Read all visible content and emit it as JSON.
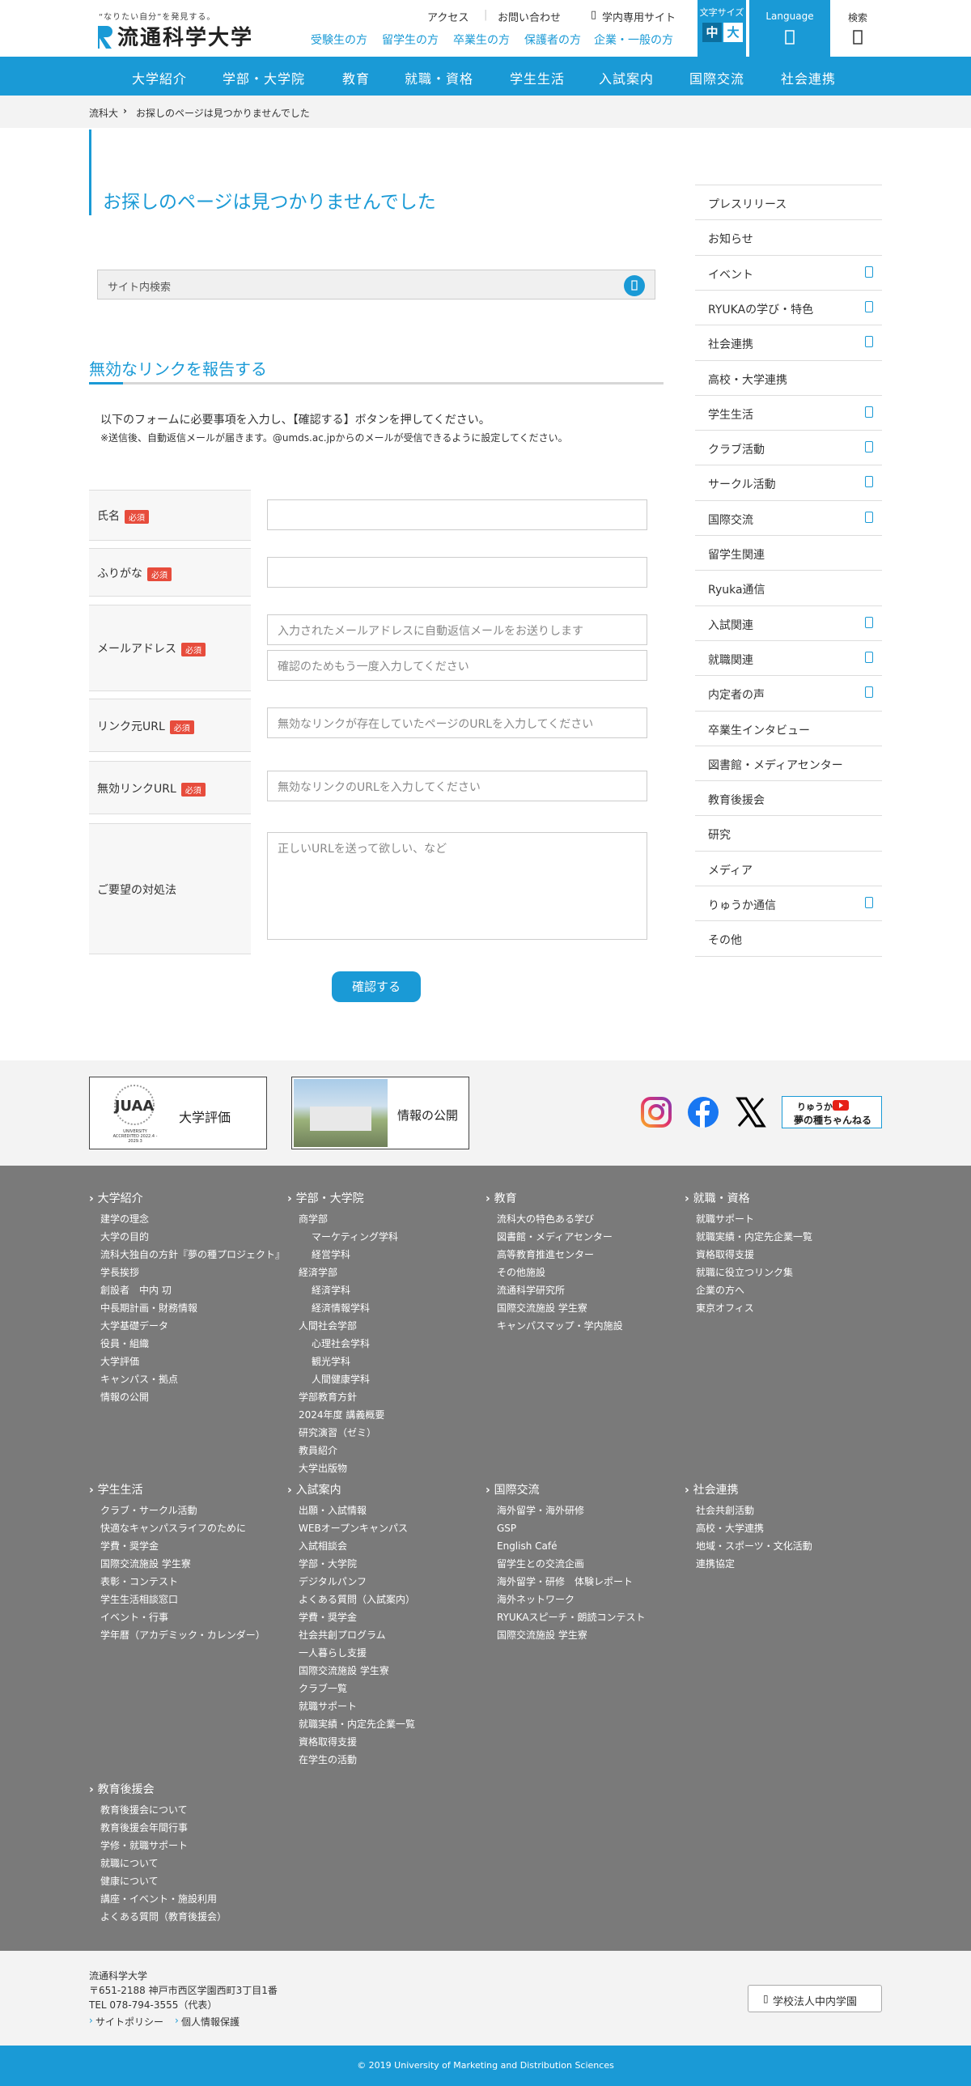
{
  "header": {
    "tagline": "“なりたい自分”を発見する。",
    "logo_name": "流通科学大学",
    "util_links": [
      "アクセス",
      "お問い合わせ",
      "学内専用サイト"
    ],
    "audience_links": [
      "受験生の方",
      "留学生の方",
      "卒業生の方",
      "保護者の方",
      "企業・一般の方"
    ],
    "fontsize_label": "文字サイズ",
    "fontsize_medium": "中",
    "fontsize_large": "大",
    "language_label": "Language",
    "search_label": "検索"
  },
  "gnav": [
    "大学紹介",
    "学部・大学院",
    "教育",
    "就職・資格",
    "学生生活",
    "入試案内",
    "国際交流",
    "社会連携"
  ],
  "breadcrumb": {
    "home": "流科大",
    "current": "お探しのページは見つかりませんでした"
  },
  "main": {
    "title": "お探しのページは見つかりませんでした",
    "site_search_placeholder": "サイト内検索",
    "section_title": "無効なリンクを報告する",
    "intro": "以下のフォームに必要事項を入力し、【確認する】ボタンを押してください。",
    "note": "※送信後、自動返信メールが届きます。@umds.ac.jpからのメールが受信できるように設定してください。",
    "required_badge": "必須",
    "form": {
      "name_label": "氏名",
      "kana_label": "ふりがな",
      "email_label": "メールアドレス",
      "email_placeholder": "入力されたメールアドレスに自動返信メールをお送りします",
      "email_confirm_placeholder": "確認のためもう一度入力してください",
      "source_url_label": "リンク元URL",
      "source_url_placeholder": "無効なリンクが存在していたページのURLを入力してください",
      "invalid_url_label": "無効リンクURL",
      "invalid_url_placeholder": "無効なリンクのURLを入力してください",
      "request_label": "ご要望の対処法",
      "request_placeholder": "正しいURLを送って欲しい、など"
    },
    "confirm_button": "確認する"
  },
  "sidebar": [
    {
      "label": "プレスリリース",
      "sub": false
    },
    {
      "label": "お知らせ",
      "sub": false
    },
    {
      "label": "イベント",
      "sub": true
    },
    {
      "label": "RYUKAの学び・特色",
      "sub": true
    },
    {
      "label": "社会連携",
      "sub": true
    },
    {
      "label": "高校・大学連携",
      "sub": false
    },
    {
      "label": "学生生活",
      "sub": true
    },
    {
      "label": "クラブ活動",
      "sub": true
    },
    {
      "label": "サークル活動",
      "sub": true
    },
    {
      "label": "国際交流",
      "sub": true
    },
    {
      "label": "留学生関連",
      "sub": false
    },
    {
      "label": "Ryuka通信",
      "sub": false
    },
    {
      "label": "入試関連",
      "sub": true
    },
    {
      "label": "就職関連",
      "sub": true
    },
    {
      "label": "内定者の声",
      "sub": true
    },
    {
      "label": "卒業生インタビュー",
      "sub": false
    },
    {
      "label": "図書館・メディアセンター",
      "sub": false
    },
    {
      "label": "教育後援会",
      "sub": false
    },
    {
      "label": "研究",
      "sub": false
    },
    {
      "label": "メディア",
      "sub": false
    },
    {
      "label": "りゅうか通信",
      "sub": true
    },
    {
      "label": "その他",
      "sub": false
    }
  ],
  "banners": {
    "eval_label": "大学評価",
    "eval_logo_text": "UNIVERSITY ACCREDITED 2022.4 - 2029.3",
    "info_label": "情報の公開",
    "yume_label_1": "りゅうか",
    "yume_label_2": "夢の種ちゃんねる",
    "sns": [
      "instagram-icon",
      "facebook-icon",
      "x-icon"
    ]
  },
  "sitemap": [
    {
      "head": "大学紹介",
      "items": [
        [
          "建学の理念",
          0
        ],
        [
          "大学の目的",
          0
        ],
        [
          "流科大独自の方針『夢の種プロジェクト』",
          0
        ],
        [
          "学長挨拶",
          0
        ],
        [
          "創設者　中内 㓛",
          0
        ],
        [
          "中長期計画・財務情報",
          0
        ],
        [
          "大学基礎データ",
          0
        ],
        [
          "役員・組織",
          0
        ],
        [
          "大学評価",
          0
        ],
        [
          "キャンパス・拠点",
          0
        ],
        [
          "情報の公開",
          0
        ]
      ]
    },
    {
      "head": "学部・大学院",
      "items": [
        [
          "商学部",
          0
        ],
        [
          "マーケティング学科",
          1
        ],
        [
          "経営学科",
          1
        ],
        [
          "経済学部",
          0
        ],
        [
          "経済学科",
          1
        ],
        [
          "経済情報学科",
          1
        ],
        [
          "人間社会学部",
          0
        ],
        [
          "心理社会学科",
          1
        ],
        [
          "観光学科",
          1
        ],
        [
          "人間健康学科",
          1
        ],
        [
          "学部教育方針",
          0
        ],
        [
          "2024年度 講義概要",
          0
        ],
        [
          "研究演習（ゼミ）",
          0
        ],
        [
          "教員紹介",
          0
        ],
        [
          "大学出版物",
          0
        ]
      ]
    },
    {
      "head": "教育",
      "items": [
        [
          "流科大の特色ある学び",
          0
        ],
        [
          "図書館・メディアセンター",
          0
        ],
        [
          "高等教育推進センター",
          0
        ],
        [
          "その他施設",
          0
        ],
        [
          "流通科学研究所",
          0
        ],
        [
          "国際交流施設 学生寮",
          0
        ],
        [
          "キャンパスマップ・学内施設",
          0
        ]
      ]
    },
    {
      "head": "就職・資格",
      "items": [
        [
          "就職サポート",
          0
        ],
        [
          "就職実績・内定先企業一覧",
          0
        ],
        [
          "資格取得支援",
          0
        ],
        [
          "就職に役立つリンク集",
          0
        ],
        [
          "企業の方へ",
          0
        ],
        [
          "東京オフィス",
          0
        ]
      ]
    },
    {
      "head": "学生生活",
      "items": [
        [
          "クラブ・サークル活動",
          0
        ],
        [
          "快適なキャンパスライフのために",
          0
        ],
        [
          "学費・奨学金",
          0
        ],
        [
          "国際交流施設 学生寮",
          0
        ],
        [
          "表彰・コンテスト",
          0
        ],
        [
          "学生生活相談窓口",
          0
        ],
        [
          "イベント・行事",
          0
        ],
        [
          "学年暦（アカデミック・カレンダー）",
          0
        ]
      ]
    },
    {
      "head": "入試案内",
      "items": [
        [
          "出願・入試情報",
          0
        ],
        [
          "WEBオープンキャンパス",
          0
        ],
        [
          "入試相談会",
          0
        ],
        [
          "学部・大学院",
          0
        ],
        [
          "デジタルパンフ",
          0
        ],
        [
          "よくある質問（入試案内）",
          0
        ],
        [
          "学費・奨学金",
          0
        ],
        [
          "社会共創プログラム",
          0
        ],
        [
          "一人暮らし支援",
          0
        ],
        [
          "国際交流施設 学生寮",
          0
        ],
        [
          "クラブ一覧",
          0
        ],
        [
          "就職サポート",
          0
        ],
        [
          "就職実績・内定先企業一覧",
          0
        ],
        [
          "資格取得支援",
          0
        ],
        [
          "在学生の活動",
          0
        ]
      ]
    },
    {
      "head": "国際交流",
      "items": [
        [
          "海外留学・海外研修",
          0
        ],
        [
          "GSP",
          0
        ],
        [
          "English Café",
          0
        ],
        [
          "留学生との交流企画",
          0
        ],
        [
          "海外留学・研修　体験レポート",
          0
        ],
        [
          "海外ネットワーク",
          0
        ],
        [
          "RYUKAスピーチ・朗読コンテスト",
          0
        ],
        [
          "国際交流施設 学生寮",
          0
        ]
      ]
    },
    {
      "head": "社会連携",
      "items": [
        [
          "社会共創活動",
          0
        ],
        [
          "高校・大学連携",
          0
        ],
        [
          "地域・スポーツ・文化活動",
          0
        ],
        [
          "連携協定",
          0
        ]
      ]
    },
    {
      "head": "教育後援会",
      "items": [
        [
          "教育後援会について",
          0
        ],
        [
          "教育後援会年間行事",
          0
        ],
        [
          "学修・就職サポート",
          0
        ],
        [
          "就職について",
          0
        ],
        [
          "健康について",
          0
        ],
        [
          "講座・イベント・施設利用",
          0
        ],
        [
          "よくある質問（教育後援会）",
          0
        ]
      ]
    }
  ],
  "address": {
    "name": "流通科学大学",
    "postal": "〒651-2188 神戸市西区学園西町3丁目1番",
    "tel": "TEL 078-794-3555（代表）",
    "policy": "サイトポリシー",
    "privacy": "個人情報保護",
    "corp_button": "学校法人中内学園"
  },
  "copyright": "© 2019 University of Marketing and Distribution Sciences",
  "colors": {
    "accent": "#1a9ad6",
    "footer_bg": "#7a7a7a",
    "required": "#e74c3c"
  }
}
